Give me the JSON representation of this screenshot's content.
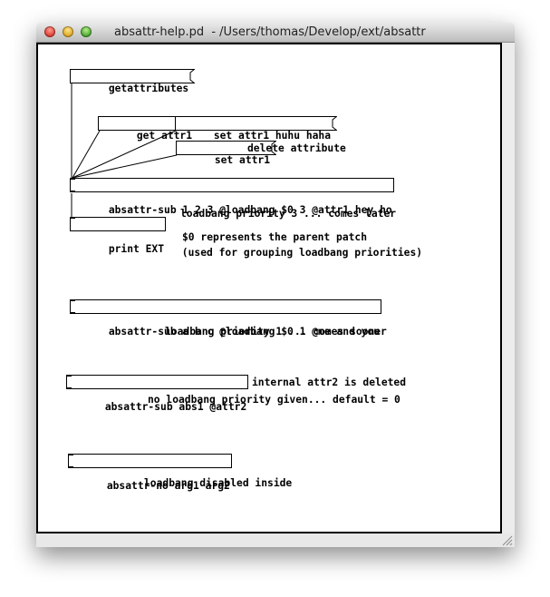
{
  "window": {
    "title": "absattr-help.pd  - /Users/thomas/Develop/ext/absattr"
  },
  "patch": {
    "messages": {
      "getattributes": "getattributes",
      "get_attr1": "get attr1",
      "set_attr1_huhu_haha": "set attr1 huhu haha",
      "set_attr1": "set attr1"
    },
    "objects": {
      "absattr_sub_main": "absattr-sub 1 2 3 @loadbang $0 3 @attr1 hey ho",
      "print_ext": "print EXT",
      "absattr_sub_abc": "absattr-sub a b c @loadbang $0 1 @me and you",
      "absattr_sub_abs1": "absattr-sub abs1 @attr2",
      "absattr_no": "absattr-no arg1 arg2"
    },
    "comments": {
      "delete_attribute": "delete attribute",
      "priority_3": "loadbang priority 3 ... comes later",
      "dollar0_line1": "$0 represents the parent patch",
      "dollar0_line2": " (used for grouping loadbang priorities)",
      "priority_1": "loadbang priority 1 ... comes sooner",
      "attr2_deleted": "internal attr2 is deleted",
      "no_priority": "no loadbang priority given... default = 0",
      "loadbang_disabled": "loadbang disabled inside"
    }
  },
  "colors": {
    "canvas": "#ffffff",
    "ink": "#000000",
    "chrome": "#ececec"
  },
  "icons": [
    "close-light-icon",
    "minimize-light-icon",
    "zoom-light-icon",
    "resize-grip-icon"
  ]
}
